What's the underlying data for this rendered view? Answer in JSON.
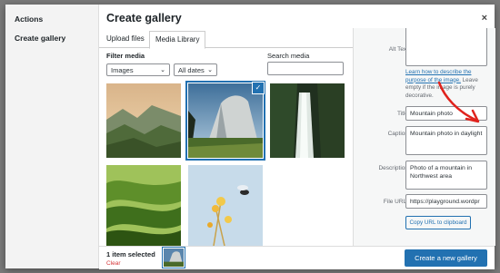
{
  "background": {
    "hint": "Gallery • Post"
  },
  "sidebar": {
    "items": [
      {
        "label": "Actions"
      },
      {
        "label": "Create gallery"
      }
    ]
  },
  "modal": {
    "title": "Create gallery",
    "close": "×"
  },
  "tabs": [
    {
      "label": "Upload files"
    },
    {
      "label": "Media Library"
    }
  ],
  "filter": {
    "label": "Filter media",
    "type_value": "Images",
    "date_value": "All dates"
  },
  "search": {
    "label": "Search media",
    "value": ""
  },
  "media": [
    {
      "name": "mountain-valley-photo",
      "selected": false
    },
    {
      "name": "mountain-photo",
      "selected": true
    },
    {
      "name": "waterfall-photo",
      "selected": false
    },
    {
      "name": "green-hills-photo",
      "selected": false
    },
    {
      "name": "yellow-flowers-bee-photo",
      "selected": false
    }
  ],
  "details": {
    "alt_label": "Alt Text",
    "alt_help_link": "Learn how to describe the purpose of the image.",
    "alt_help_rest": "Leave empty if the image is purely decorative.",
    "title_label": "Title",
    "title_value": "Mountain photo",
    "caption_label": "Caption",
    "caption_value": "Mountain photo in daylight",
    "description_label": "Description",
    "description_value": "Photo of a mountain in Northwest area",
    "fileurl_label": "File URL:",
    "fileurl_value": "https://playground.wordpr",
    "copy_button": "Copy URL to clipboard"
  },
  "footer": {
    "selected_count": "1 item selected",
    "clear": "Clear",
    "primary_button": "Create a new gallery"
  },
  "colors": {
    "accent": "#2271b1",
    "arrow": "#e0231d",
    "clear": "#d63638"
  }
}
